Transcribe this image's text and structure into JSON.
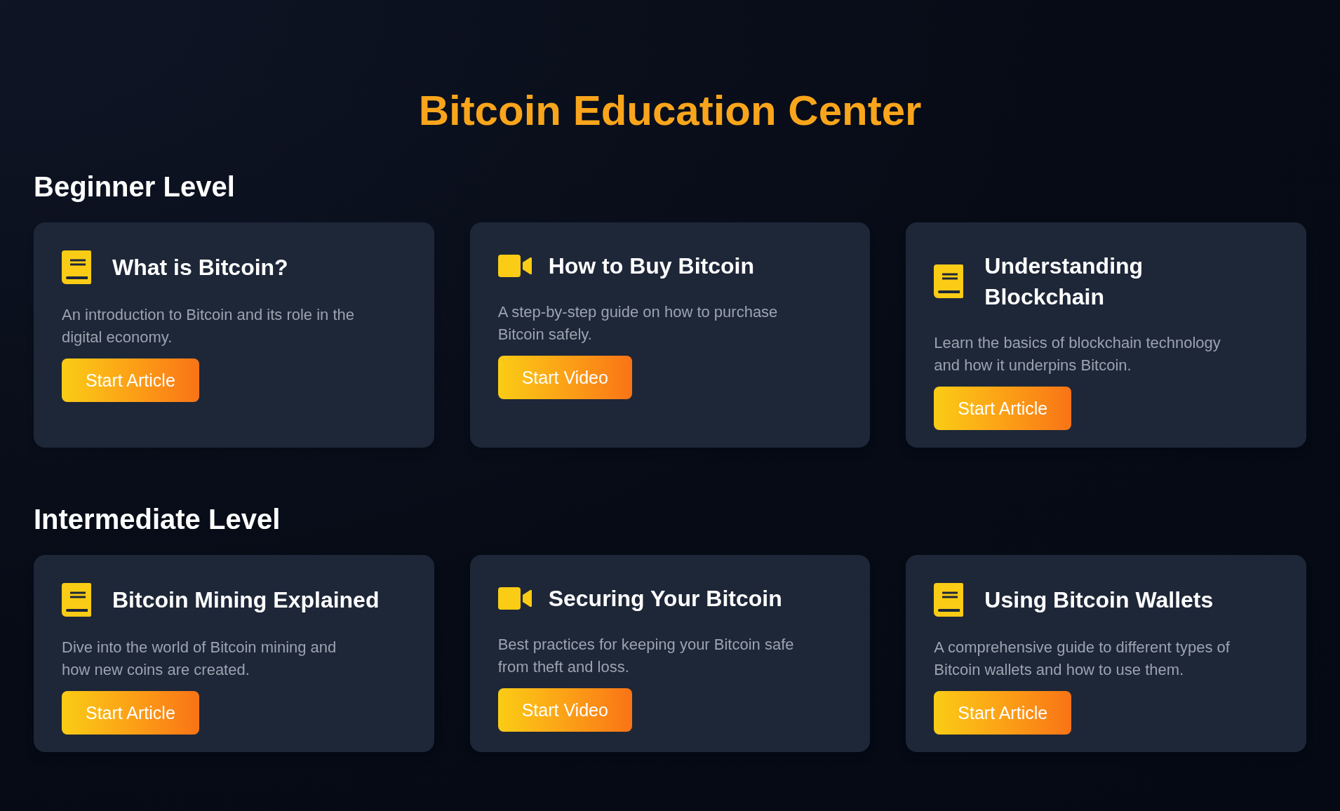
{
  "page_title": "Bitcoin Education Center",
  "sections": [
    {
      "heading": "Beginner Level",
      "lessons": [
        {
          "kind": "article",
          "title": "What is Bitcoin?",
          "description": "An introduction to Bitcoin and its role in the digital economy.",
          "button": "Start Article"
        },
        {
          "kind": "video",
          "title": "How to Buy Bitcoin",
          "description": "A step-by-step guide on how to purchase Bitcoin safely.",
          "button": "Start Video"
        },
        {
          "kind": "article",
          "title": "Understanding Blockchain",
          "description": "Learn the basics of blockchain technology and how it underpins Bitcoin.",
          "button": "Start Article"
        }
      ]
    },
    {
      "heading": "Intermediate Level",
      "lessons": [
        {
          "kind": "article",
          "title": "Bitcoin Mining Explained",
          "description": "Dive into the world of Bitcoin mining and how new coins are created.",
          "button": "Start Article"
        },
        {
          "kind": "video",
          "title": "Securing Your Bitcoin",
          "description": "Best practices for keeping your Bitcoin safe from theft and loss.",
          "button": "Start Video"
        },
        {
          "kind": "article",
          "title": "Using Bitcoin Wallets",
          "description": "A comprehensive guide to different types of Bitcoin wallets and how to use them.",
          "button": "Start Article"
        }
      ]
    }
  ]
}
